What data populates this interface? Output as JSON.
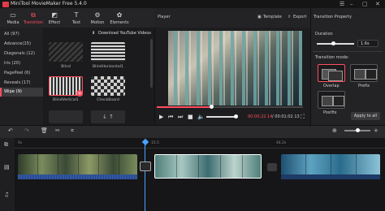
{
  "app": {
    "title": "MiniTool MovieMaker Free 5.4.0"
  },
  "toolbar": {
    "tabs": [
      {
        "label": "Media",
        "icon": "folder-icon"
      },
      {
        "label": "Transition",
        "icon": "transition-icon"
      },
      {
        "label": "Effect",
        "icon": "effect-icon"
      },
      {
        "label": "Text",
        "icon": "text-icon"
      },
      {
        "label": "Motion",
        "icon": "motion-icon"
      },
      {
        "label": "Elements",
        "icon": "elements-icon"
      }
    ],
    "active": "Transition"
  },
  "categories": [
    {
      "label": "All (97)"
    },
    {
      "label": "Advance(15)"
    },
    {
      "label": "Diagonals (12)"
    },
    {
      "label": "Iris (20)"
    },
    {
      "label": "PagePeel (6)"
    },
    {
      "label": "Reveals (17)"
    },
    {
      "label": "Wipe (9)"
    }
  ],
  "download": {
    "label": "Download YouTube Videos"
  },
  "transitions": [
    {
      "label": "Blind"
    },
    {
      "label": "BlindHorizontal1"
    },
    {
      "label": "BlindVertical1"
    },
    {
      "label": "CheckBoard"
    },
    {
      "label": ""
    },
    {
      "label": ""
    }
  ],
  "player": {
    "title": "Player",
    "template_label": "Template",
    "export_label": "Export",
    "current_time": "00:00:22.14",
    "total_time": "/ 00:01:02.13",
    "progress": 0.37
  },
  "properties": {
    "title": "Transition Property",
    "duration_label": "Duration",
    "duration_value": "1.6s",
    "mode_label": "Transition mode:",
    "modes": [
      {
        "label": "Overlap"
      },
      {
        "label": "Prefix"
      },
      {
        "label": "Postfix"
      }
    ],
    "apply_all_label": "Apply to all"
  },
  "timeline": {
    "ruler": [
      "0s",
      "15.5",
      "44.2s"
    ],
    "colors": {
      "accent": "#ff4d5e",
      "playhead": "#4aa3ff"
    }
  }
}
